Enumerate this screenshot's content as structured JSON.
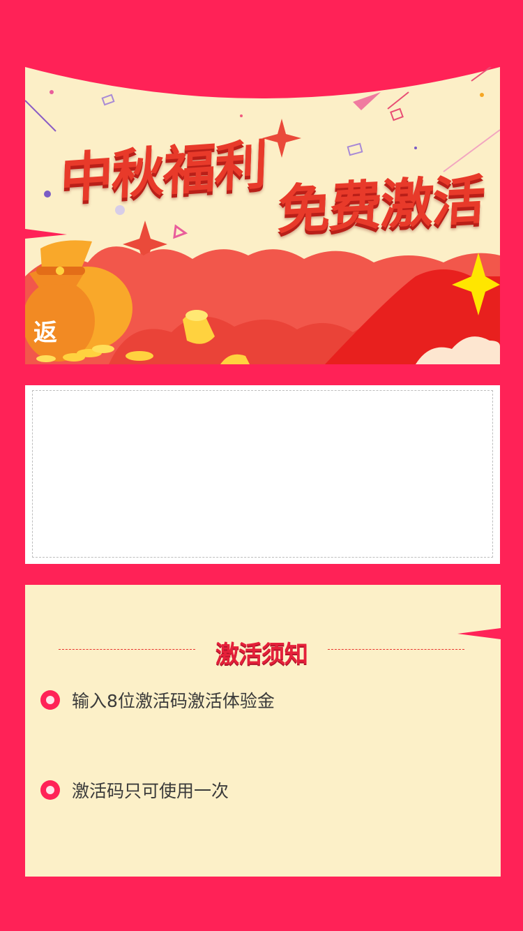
{
  "banner": {
    "title_left": "中秋福利",
    "title_right": "免费激活",
    "bag_label": "返"
  },
  "code_input": {
    "value": "",
    "placeholder": ""
  },
  "notice": {
    "title": "激活须知",
    "rules": [
      "输入8位激活码激活体验金",
      "激活码只可使用一次"
    ]
  },
  "colors": {
    "page_background": "#ff2257",
    "banner_cream": "#fcefc7",
    "notice_background": "#fcf0c8",
    "title_red": "#e5203a",
    "bullet": "#ff2257"
  }
}
